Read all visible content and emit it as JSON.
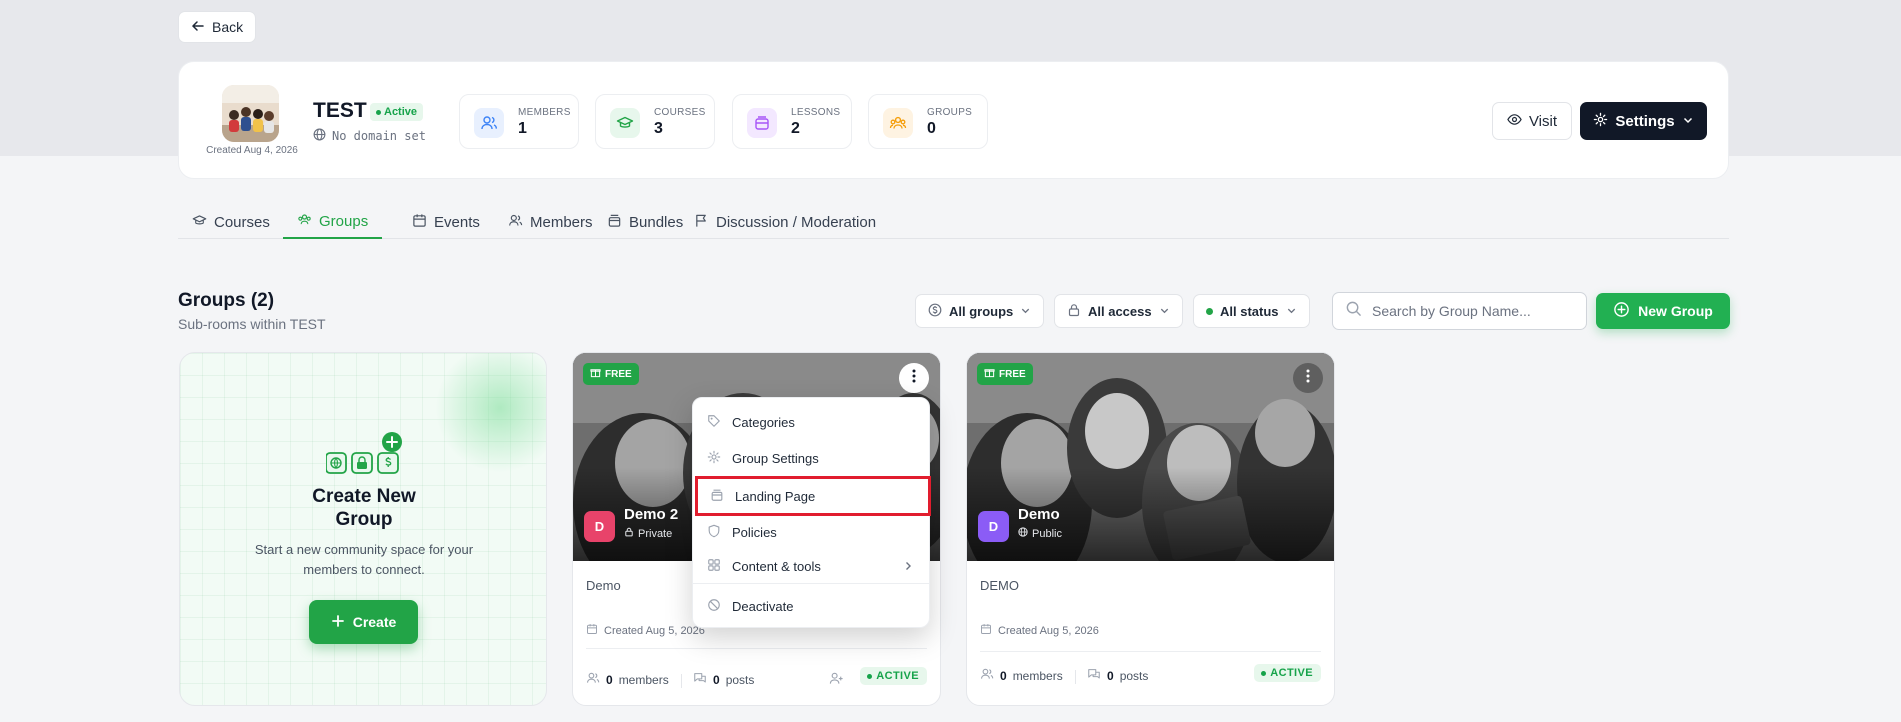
{
  "nav": {
    "back_label": "Back"
  },
  "community": {
    "name": "TEST",
    "status": "Active",
    "domain": "No domain set",
    "created": "Created Aug 4, 2026",
    "stats": [
      {
        "label": "MEMBERS",
        "value": "1",
        "icon": "members-icon",
        "color": "#3b82f6"
      },
      {
        "label": "COURSES",
        "value": "3",
        "icon": "courses-icon",
        "color": "#22a447"
      },
      {
        "label": "LESSONS",
        "value": "2",
        "icon": "lessons-icon",
        "color": "#a855f7"
      },
      {
        "label": "GROUPS",
        "value": "0",
        "icon": "groups-icon",
        "color": "#f59e0b"
      }
    ],
    "visit_label": "Visit",
    "settings_label": "Settings"
  },
  "tabs": [
    {
      "label": "Courses",
      "icon": "graduation-cap-icon"
    },
    {
      "label": "Groups",
      "icon": "groups-icon",
      "active": true
    },
    {
      "label": "Events",
      "icon": "calendar-icon"
    },
    {
      "label": "Members",
      "icon": "users-icon"
    },
    {
      "label": "Bundles",
      "icon": "box-icon"
    },
    {
      "label": "Discussion / Moderation",
      "icon": "flag-icon"
    }
  ],
  "groups_section": {
    "title": "Groups (2)",
    "subtitle": "Sub-rooms within TEST",
    "filters": [
      "All groups",
      "All access",
      "All status"
    ],
    "search_placeholder": "Search by Group Name...",
    "new_group_label": "New Group"
  },
  "create_card": {
    "title": "Create New Group",
    "description": "Start a new community space for your members to connect.",
    "button_label": "Create"
  },
  "groups": [
    {
      "name": "Demo 2",
      "initial": "D",
      "initial_color": "#e8436a",
      "visibility": "Private",
      "badge": "FREE",
      "description": "Demo",
      "created": "Created Aug 5, 2026",
      "members": "0",
      "members_label": "members",
      "posts": "0",
      "posts_label": "posts",
      "status": "ACTIVE"
    },
    {
      "name": "Demo",
      "initial": "D",
      "initial_color": "#8b5cf6",
      "visibility": "Public",
      "badge": "FREE",
      "description": "DEMO",
      "created": "Created Aug 5, 2026",
      "members": "0",
      "members_label": "members",
      "posts": "0",
      "posts_label": "posts",
      "status": "ACTIVE"
    }
  ],
  "context_menu": {
    "items": [
      {
        "label": "Categories",
        "icon": "tag-icon"
      },
      {
        "label": "Group Settings",
        "icon": "gear-icon"
      },
      {
        "label": "Landing Page",
        "icon": "landing-page-icon",
        "highlighted": true
      },
      {
        "label": "Policies",
        "icon": "shield-icon"
      },
      {
        "label": "Content & tools",
        "icon": "grid-icon",
        "submenu": true
      },
      {
        "label": "Deactivate",
        "icon": "ban-icon"
      }
    ]
  },
  "colors": {
    "accent": "#22a447",
    "dark": "#111827",
    "highlight_outline": "#e11d2e"
  }
}
